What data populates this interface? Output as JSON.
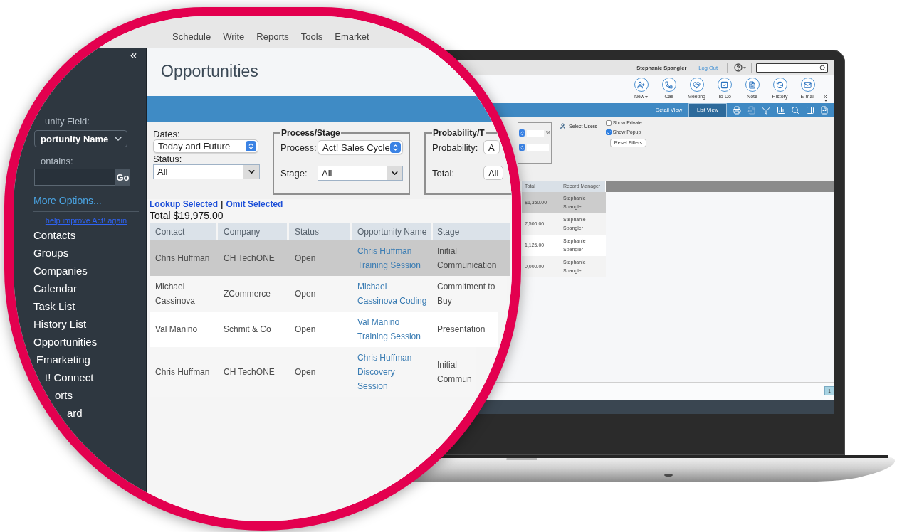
{
  "magnifier": {
    "menu": [
      "Schedule",
      "Write",
      "Reports",
      "Tools",
      "Emarket"
    ],
    "sidebar": {
      "field_label": "unity Field:",
      "field_value": "portunity Name",
      "contains_label": "ontains:",
      "go": "Go",
      "more_options": "More Options...",
      "help_link": "help improve Act! again",
      "nav": [
        "Contacts",
        "Groups",
        "Companies",
        "Calendar",
        "Task List",
        "History List",
        "Opportunities",
        "Emarketing",
        "t! Connect",
        "orts",
        "ard"
      ]
    },
    "title": "Opportunities",
    "filters": {
      "dates": {
        "label": "Dates:",
        "value": "Today and Future",
        "kind": "stepper"
      },
      "status": {
        "label": "Status:",
        "value": "All",
        "kind": "dropdown"
      },
      "groups": [
        {
          "legend": "Process/Stage",
          "fields": [
            {
              "label": "Process:",
              "value": "Act! Sales Cycle",
              "kind": "stepper"
            },
            {
              "label": "Stage:",
              "value": "All",
              "kind": "dropdown"
            }
          ]
        },
        {
          "legend": "Probability/T",
          "fields": [
            {
              "label": "Probability:",
              "value": "A",
              "kind": "plain"
            },
            {
              "label": "Total:",
              "value": "All",
              "kind": "plain"
            }
          ]
        }
      ]
    },
    "actions": {
      "lookup": "Lookup Selected",
      "separator": "|",
      "omit": "Omit Selected"
    },
    "total": "Total $19,975.00",
    "table": {
      "columns": [
        "Contact",
        "Company",
        "Status",
        "Opportunity Name",
        "Stage"
      ],
      "rows": [
        {
          "selected": true,
          "cells": [
            "Chris Huffman",
            "CH TechONE",
            "Open",
            "Chris Huffman Training Session",
            "Initial Communication"
          ]
        },
        {
          "selected": false,
          "cells": [
            "Michael Cassinova",
            "ZCommerce",
            "Open",
            "Michael Cassinova Coding",
            "Commitment to Buy"
          ]
        },
        {
          "selected": false,
          "cells": [
            "Val Manino",
            "Schmit & Co",
            "Open",
            "Val Manino Training Session",
            "Presentation"
          ]
        },
        {
          "selected": false,
          "cells": [
            "Chris Huffman",
            "CH TechONE",
            "Open",
            "Chris Huffman Discovery Session",
            "Initial Commun"
          ]
        }
      ]
    }
  },
  "laptop": {
    "user": "Stephanie Spangler",
    "logout": "Log Out",
    "actions": [
      {
        "label": "New",
        "kind": "new",
        "menu": true
      },
      {
        "label": "Call",
        "kind": "call",
        "menu": false
      },
      {
        "label": "Meeting",
        "kind": "meeting",
        "menu": false
      },
      {
        "label": "To-Do",
        "kind": "todo",
        "menu": false
      },
      {
        "label": "Note",
        "kind": "note",
        "menu": false
      },
      {
        "label": "History",
        "kind": "history",
        "menu": false
      },
      {
        "label": "E-mail",
        "kind": "email",
        "menu": false
      }
    ],
    "views": [
      {
        "label": "Detail View",
        "selected": false
      },
      {
        "label": "List View",
        "selected": true
      }
    ],
    "tools": [
      {
        "kind": "print",
        "disabled": false
      },
      {
        "kind": "export",
        "disabled": true
      },
      {
        "kind": "filter",
        "disabled": false
      },
      {
        "kind": "chart",
        "disabled": false
      },
      {
        "kind": "search",
        "disabled": false
      },
      {
        "kind": "columns",
        "disabled": false
      },
      {
        "kind": "excel",
        "disabled": false
      }
    ],
    "percent": "%",
    "select_users": "Select Users",
    "options": [
      {
        "label": "Show Private",
        "checked": false
      },
      {
        "label": "Show Popup",
        "checked": true
      }
    ],
    "reset": "Reset Filters",
    "table": {
      "columns": [
        "Total",
        "Record Manager"
      ],
      "rows": [
        {
          "selected": true,
          "cells": [
            "$1,350.00",
            "Stephanie Spangler"
          ]
        },
        {
          "selected": false,
          "cells": [
            "7,500.00",
            "Stephanie Spangler"
          ]
        },
        {
          "selected": false,
          "cells": [
            "1,125.00",
            "Stephanie Spangler"
          ]
        },
        {
          "selected": false,
          "cells": [
            "0,000.00",
            "Stephanie Spangler"
          ]
        }
      ]
    },
    "pages": [
      {
        "label": "1",
        "selected": true
      }
    ]
  }
}
